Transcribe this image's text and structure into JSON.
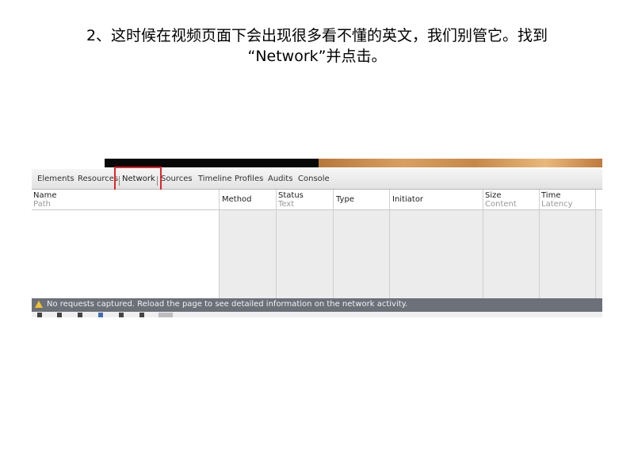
{
  "caption": {
    "line1": "2、这时候在视频页面下会出现很多看不懂的英文，我们别管它。找到",
    "line2": "“Network”并点击。"
  },
  "devtools": {
    "tabs": [
      "Elements",
      "Resources",
      "Network",
      "Sources",
      "Timeline",
      "Profiles",
      "Audits",
      "Console"
    ],
    "selected_tab": "Network",
    "highlight_color": "#e0262b",
    "columns": {
      "name": {
        "primary": "Name",
        "secondary": "Path"
      },
      "method": {
        "primary": "Method"
      },
      "status": {
        "primary": "Status",
        "secondary": "Text"
      },
      "type": {
        "primary": "Type"
      },
      "initiator": {
        "primary": "Initiator"
      },
      "size": {
        "primary": "Size",
        "secondary": "Content"
      },
      "time": {
        "primary": "Time",
        "secondary": "Latency"
      }
    },
    "status_message": "No requests captured. Reload the page to see detailed information on the network activity.",
    "status_icon": "warning-icon"
  }
}
